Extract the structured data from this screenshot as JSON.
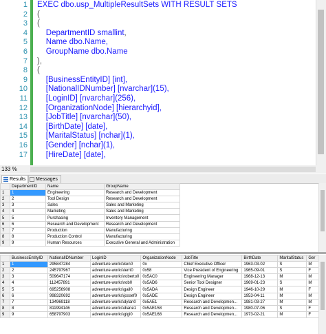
{
  "editor": {
    "lines": [
      {
        "n": "1",
        "parts": [
          {
            "t": "EXEC ",
            "c": "kw"
          },
          {
            "t": "dbo.usp_MultipleResultSets",
            "c": "id"
          },
          {
            "t": " WITH RESULT SETS",
            "c": "kw"
          }
        ]
      },
      {
        "n": "2",
        "parts": [
          {
            "t": "(",
            "c": "pu"
          }
        ]
      },
      {
        "n": "3",
        "parts": [
          {
            "t": "(",
            "c": "pu"
          }
        ]
      },
      {
        "n": "4",
        "parts": [
          {
            "t": "    DepartmentID ",
            "c": "id"
          },
          {
            "t": "smallint",
            "c": "ty"
          },
          {
            "t": ",",
            "c": "pu"
          }
        ]
      },
      {
        "n": "5",
        "parts": [
          {
            "t": "    Name dbo.Name,",
            "c": "id"
          }
        ]
      },
      {
        "n": "6",
        "parts": [
          {
            "t": "    GroupName dbo.Name",
            "c": "id"
          }
        ]
      },
      {
        "n": "7",
        "parts": [
          {
            "t": "),",
            "c": "pu"
          }
        ]
      },
      {
        "n": "8",
        "parts": [
          {
            "t": "(",
            "c": "pu"
          }
        ]
      },
      {
        "n": "9",
        "parts": [
          {
            "t": "    [BusinessEntityID] [int],",
            "c": "id"
          }
        ]
      },
      {
        "n": "10",
        "parts": [
          {
            "t": "    [NationalIDNumber] [nvarchar](15),",
            "c": "id"
          }
        ]
      },
      {
        "n": "11",
        "parts": [
          {
            "t": "    [LoginID] [nvarchar](256),",
            "c": "id"
          }
        ]
      },
      {
        "n": "12",
        "parts": [
          {
            "t": "    [OrganizationNode] [hierarchyid],",
            "c": "id"
          }
        ]
      },
      {
        "n": "13",
        "parts": [
          {
            "t": "    [JobTitle] [nvarchar](50),",
            "c": "id"
          }
        ]
      },
      {
        "n": "14",
        "parts": [
          {
            "t": "    [BirthDate] [date],",
            "c": "id"
          }
        ]
      },
      {
        "n": "15",
        "parts": [
          {
            "t": "    [MaritalStatus] [nchar](1),",
            "c": "id"
          }
        ]
      },
      {
        "n": "16",
        "parts": [
          {
            "t": "    [Gender] [nchar](1),",
            "c": "id"
          }
        ]
      },
      {
        "n": "17",
        "parts": [
          {
            "t": "    [HireDate] [date],",
            "c": "id"
          }
        ]
      }
    ]
  },
  "zoom": "133 %",
  "tabs": [
    {
      "label": "Results"
    },
    {
      "label": "Messages"
    }
  ],
  "grid1": {
    "columns": [
      "",
      "DepartmentID",
      "Name",
      "GroupName"
    ],
    "rows": [
      [
        "1",
        "1",
        "Engineering",
        "Research and Development"
      ],
      [
        "2",
        "2",
        "Tool Design",
        "Research and Development"
      ],
      [
        "3",
        "3",
        "Sales",
        "Sales and Marketing"
      ],
      [
        "4",
        "4",
        "Marketing",
        "Sales and Marketing"
      ],
      [
        "5",
        "5",
        "Purchasing",
        "Inventory Management"
      ],
      [
        "6",
        "6",
        "Research and Development",
        "Research and Development"
      ],
      [
        "7",
        "7",
        "Production",
        "Manufacturing"
      ],
      [
        "8",
        "8",
        "Production Control",
        "Manufacturing"
      ],
      [
        "9",
        "9",
        "Human Resources",
        "Executive General and Administration"
      ]
    ]
  },
  "grid2": {
    "columns": [
      "",
      "BusinessEntityID",
      "NationalIDNumber",
      "LoginID",
      "OrganizationNode",
      "JobTitle",
      "BirthDate",
      "MaritalStatus",
      "Ger"
    ],
    "rows": [
      [
        "1",
        "1",
        "295847284",
        "adventure-works\\ken0",
        "0x",
        "Chief Executive Officer",
        "1963-03-02",
        "S",
        "M"
      ],
      [
        "2",
        "2",
        "245797967",
        "adventure-works\\terri0",
        "0x58",
        "Vice President of Engineering",
        "1965-09-01",
        "S",
        "F"
      ],
      [
        "3",
        "3",
        "509647174",
        "adventure-works\\roberto0",
        "0x5AC0",
        "Engineering Manager",
        "1968-12-13",
        "M",
        "M"
      ],
      [
        "4",
        "4",
        "112457891",
        "adventure-works\\rob0",
        "0x5AD6",
        "Senior Tool Designer",
        "1969-01-23",
        "S",
        "M"
      ],
      [
        "5",
        "5",
        "695256908",
        "adventure-works\\gail0",
        "0x5ADA",
        "Design Engineer",
        "1946-10-29",
        "M",
        "F"
      ],
      [
        "6",
        "6",
        "998320692",
        "adventure-works\\jossef0",
        "0x5ADE",
        "Design Engineer",
        "1953-04-11",
        "M",
        "M"
      ],
      [
        "7",
        "7",
        "134969118",
        "adventure-works\\dylan0",
        "0x5AE1",
        "Research and Developmen...",
        "1981-03-27",
        "M",
        "M"
      ],
      [
        "8",
        "8",
        "811994146",
        "adventure-works\\diane1",
        "0x5AE158",
        "Research and Developmen...",
        "1980-07-06",
        "S",
        "F"
      ],
      [
        "9",
        "9",
        "658797903",
        "adventure-works\\gigi0",
        "0x5AE168",
        "Research and Developmen...",
        "1973-02-21",
        "M",
        "F"
      ]
    ]
  }
}
